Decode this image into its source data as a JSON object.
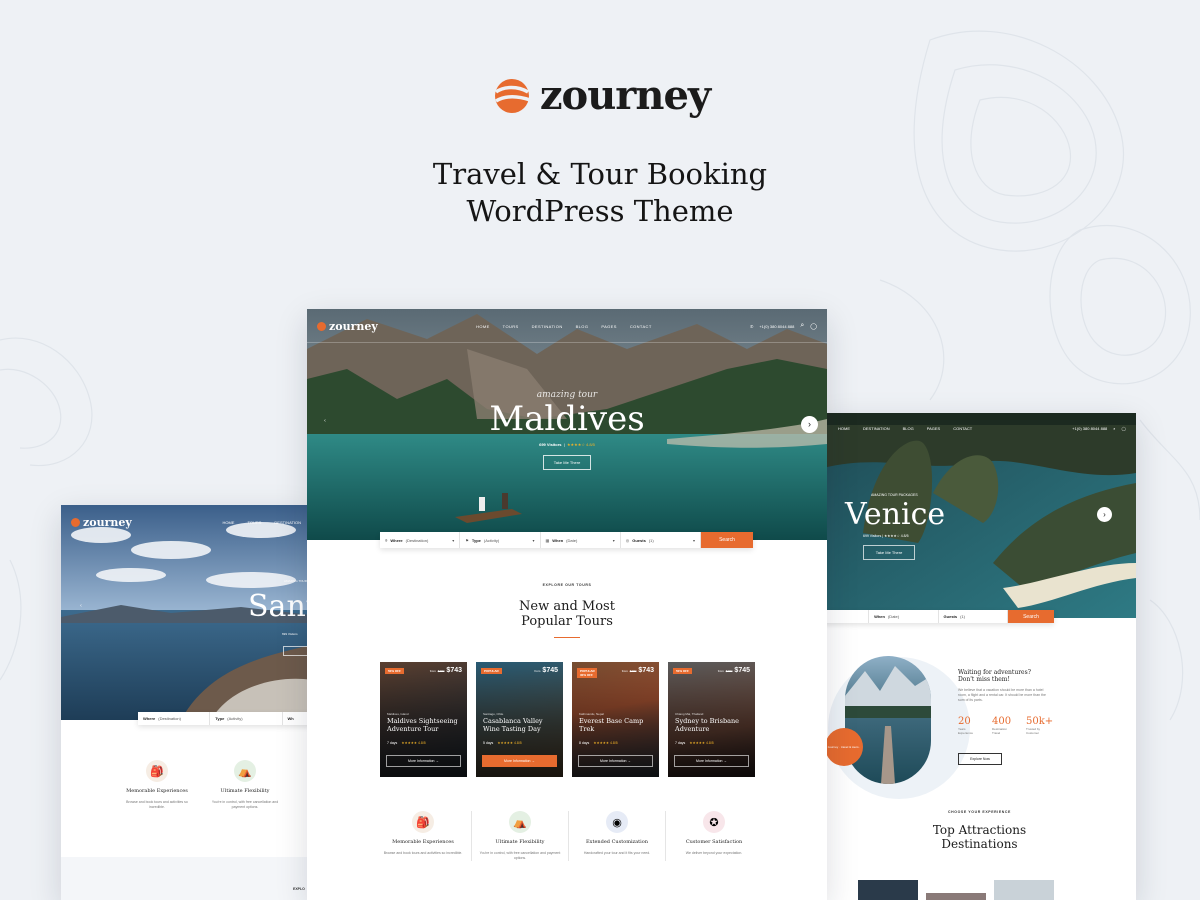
{
  "brand": {
    "name": "zourney",
    "accent": "#e76b2f"
  },
  "headline": {
    "line1": "Travel & Tour Booking",
    "line2": "WordPress Theme"
  },
  "center": {
    "nav": {
      "logo": "zourney",
      "items": [
        "HOME",
        "TOURS",
        "DESTINATION",
        "BLOG",
        "PAGES",
        "CONTACT"
      ],
      "phone": "+1(0) 380 8044 888"
    },
    "hero": {
      "script": "amazing tour",
      "title": "Maldives",
      "visitors": "699 Visitors",
      "rating": "★★★★☆ 4.8/5",
      "button": "Take Me There"
    },
    "search": {
      "where": "Where",
      "where_ph": "(Destination)",
      "type": "Type",
      "type_ph": "(Activity)",
      "when": "When",
      "when_ph": "(Date)",
      "guests": "Guests",
      "guests_ph": "(1)",
      "button": "Search"
    },
    "section": {
      "eyebrow": "EXPLORE OUR TOURS",
      "title1": "New and Most",
      "title2": "Popular Tours"
    },
    "cards": [
      {
        "badge": "50% OFF",
        "from": "from",
        "price": "$743",
        "old": "$780",
        "location": "Maldives, Island",
        "title": "Maldives Sightseeing Adventure Tour",
        "days": "7 days",
        "rating": "★★★★★ 4.8/5",
        "button": "More Information  →"
      },
      {
        "badge": "POPULAR",
        "from": "from",
        "price": "$745",
        "old": "",
        "location": "Santiago, Chile",
        "title": "Casablanca Valley Wine Tasting Day",
        "days": "5 days",
        "rating": "★★★★★ 4.8/5",
        "button": "More Information  →"
      },
      {
        "badge": "POPULAR 30% OFF",
        "from": "from",
        "price": "$743",
        "old": "$780",
        "location": "Kathmandu, Nepal",
        "title": "Everest Base Camp Trek",
        "days": "8 days",
        "rating": "★★★★★ 4.8/5",
        "button": "More Information  →"
      },
      {
        "badge": "50% OFF",
        "from": "from",
        "price": "$745",
        "old": "$780",
        "location": "Chiang Mai, Thailand",
        "title": "Sydney to Brisbane Adventure",
        "days": "7 days",
        "rating": "★★★★★ 4.8/5",
        "button": "More Information  →"
      }
    ],
    "features": [
      {
        "icon": "backpack-icon",
        "title": "Memorable Experiences",
        "text": "Browse and book tours and activities so incredible."
      },
      {
        "icon": "tent-icon",
        "title": "Ultimate Flexibility",
        "text": "You're in control, with free cancellation and payment options."
      },
      {
        "icon": "binoculars-icon",
        "title": "Extended Customization",
        "text": "Handcrafted your tour and it fits your need."
      },
      {
        "icon": "compass-icon",
        "title": "Customer Satisfaction",
        "text": "We deliver beyond your expectation."
      }
    ]
  },
  "left": {
    "nav": {
      "logo": "zourney",
      "items": [
        "HOME",
        "TOURS",
        "DESTINATION"
      ]
    },
    "hero": {
      "eyebrow": "AMAZING TOUR",
      "title": "Sant",
      "meta": "699 Visitors"
    },
    "search": {
      "where": "Where",
      "where_ph": "(Destination)",
      "type": "Type",
      "type_ph": "(Activity)",
      "when": "Wh"
    },
    "features": [
      {
        "icon": "backpack-icon",
        "title": "Memorable Experiences",
        "text": "Browse and book tours and activities so incredible."
      },
      {
        "icon": "tent-icon",
        "title": "Ultimate Flexibility",
        "text": "You're in control, with free cancellation and payment options."
      }
    ],
    "footer_eyebrow": "EXPLO"
  },
  "right": {
    "nav": {
      "items": [
        "HOME",
        "DESTINATION",
        "BLOG",
        "PAGES",
        "CONTACT"
      ],
      "phone": "+1(0) 380 8044 888"
    },
    "hero": {
      "eyebrow": "AMAZING TOUR PACKAGES",
      "title": "Venice",
      "meta": "699 Visitors  |  ★★★★☆ 4.8/5",
      "button": "Take Me There"
    },
    "search": {
      "when": "When",
      "when_ph": "(Date)",
      "guests": "Guests",
      "guests_ph": "(1)",
      "button": "Search"
    },
    "about": {
      "title": "Waiting for adventures? Don't miss them!",
      "text": "We believe that a vacation should be more than a hotel room, a flight and a rental car. It should be more than the sum of its parts.",
      "stats": [
        {
          "value": "20",
          "label": "Years Experience"
        },
        {
          "value": "400",
          "label": "Destination Travel"
        },
        {
          "value": "50k+",
          "label": "Trusted by Customer"
        }
      ],
      "button": "Explore Now",
      "badge": "zourney · travel & tours ·"
    },
    "section": {
      "eyebrow": "CHOOSE YOUR EXPERIENCE",
      "title1": "Top Attractions",
      "title2": "Destinations"
    }
  }
}
